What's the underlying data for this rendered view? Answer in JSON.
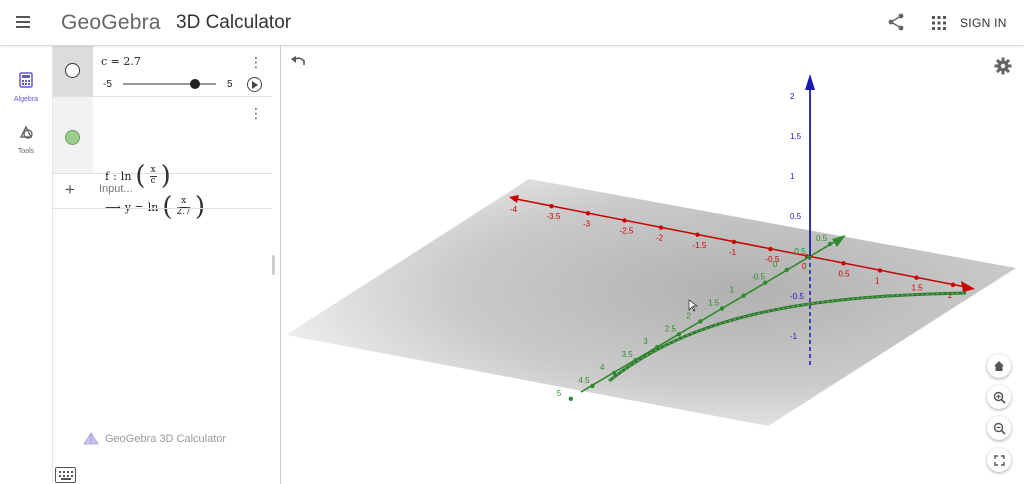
{
  "header": {
    "brand": "GeoGebra",
    "app_title": "3D Calculator",
    "sign_in": "SIGN IN"
  },
  "rail": {
    "algebra_label": "Algebra",
    "tools_label": "Tools"
  },
  "algebra": {
    "slider": {
      "definition": "c = 2.7",
      "min": "-5",
      "max": "5",
      "value": 2.7
    },
    "function": {
      "name": "f",
      "separator": ":",
      "ln": "ln",
      "def_num": "x",
      "def_den": "c",
      "result_arrow": "⟶",
      "result_lhs": "y =",
      "res_num": "x",
      "res_den": "2.7",
      "color": "#9ccc8f"
    },
    "input_placeholder": "Input...",
    "watermark": "GeoGebra 3D Calculator"
  },
  "graphics": {
    "x_axis_labels": [
      "-4",
      "-3.5",
      "-3",
      "-2.5",
      "-2",
      "-1.5",
      "-1",
      "-0.5",
      "0",
      "0.5",
      "1",
      "1.5",
      "2"
    ],
    "y_axis_labels": [
      "0.5",
      "0.5",
      "0",
      "-0.5",
      "1",
      "1.5",
      "2",
      "2.5",
      "3",
      "3.5",
      "4",
      "4.5",
      "5"
    ],
    "z_axis_labels": [
      "2",
      "1.5",
      "1",
      "0.5",
      "-0.5",
      "-1"
    ],
    "colors": {
      "x_axis": "#cc0000",
      "y_axis": "#2e8b2e",
      "z_axis": "#1a1ab3",
      "curve": "#2f7a2f",
      "plane": "#bdbdbd"
    }
  }
}
